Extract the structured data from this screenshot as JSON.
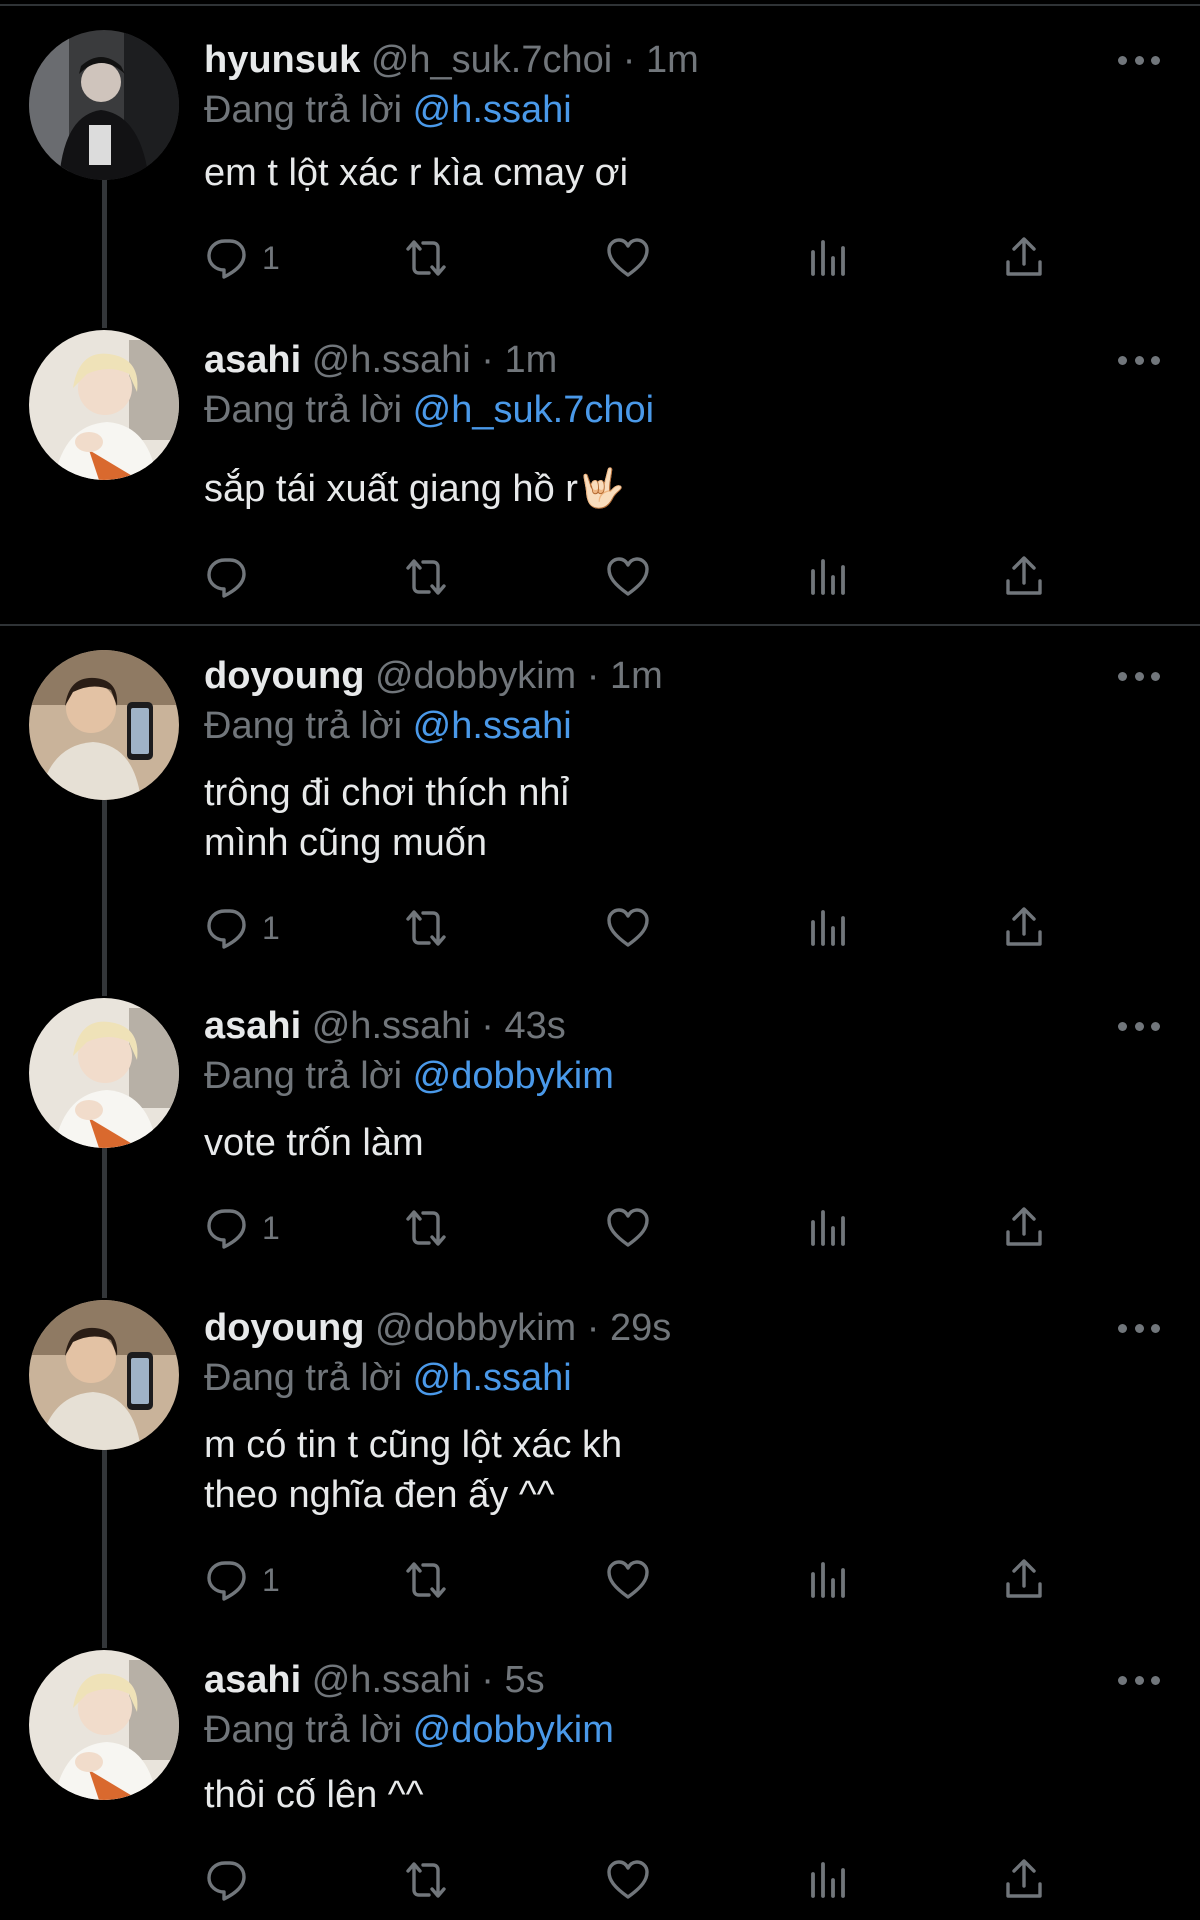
{
  "colors": {
    "background": "#000000",
    "text": "#e7e9ea",
    "muted": "#71767b",
    "mention": "#4a99e9",
    "divider": "#2f3336"
  },
  "reply_prefix": "Đang trả lời",
  "tweets": [
    {
      "name": "hyunsuk",
      "handle": "@h_suk.7choi",
      "time": "1m",
      "reply_to": "@h.ssahi",
      "text": "em t lột xác r kìa cmay ơi",
      "reply_count": "1",
      "avatar": "avatar-hyunsuk"
    },
    {
      "name": "asahi",
      "handle": "@h.ssahi",
      "time": "1m",
      "reply_to": "@h_suk.7choi",
      "text": "sắp tái xuất giang hồ r🤟🏻",
      "reply_count": "",
      "avatar": "avatar-asahi"
    },
    {
      "name": "doyoung",
      "handle": "@dobbykim",
      "time": "1m",
      "reply_to": "@h.ssahi",
      "text": "trông đi chơi thích nhỉ\nmình cũng muốn",
      "reply_count": "1",
      "avatar": "avatar-doyoung"
    },
    {
      "name": "asahi",
      "handle": "@h.ssahi",
      "time": "43s",
      "reply_to": "@dobbykim",
      "text": "vote trốn làm",
      "reply_count": "1",
      "avatar": "avatar-asahi"
    },
    {
      "name": "doyoung",
      "handle": "@dobbykim",
      "time": "29s",
      "reply_to": "@h.ssahi",
      "text": "m có tin t cũng lột xác kh\ntheo nghĩa đen ấy ^^",
      "reply_count": "1",
      "avatar": "avatar-doyoung"
    },
    {
      "name": "asahi",
      "handle": "@h.ssahi",
      "time": "5s",
      "reply_to": "@dobbykim",
      "text": "thôi cố lên ^^",
      "reply_count": "",
      "avatar": "avatar-asahi"
    }
  ]
}
